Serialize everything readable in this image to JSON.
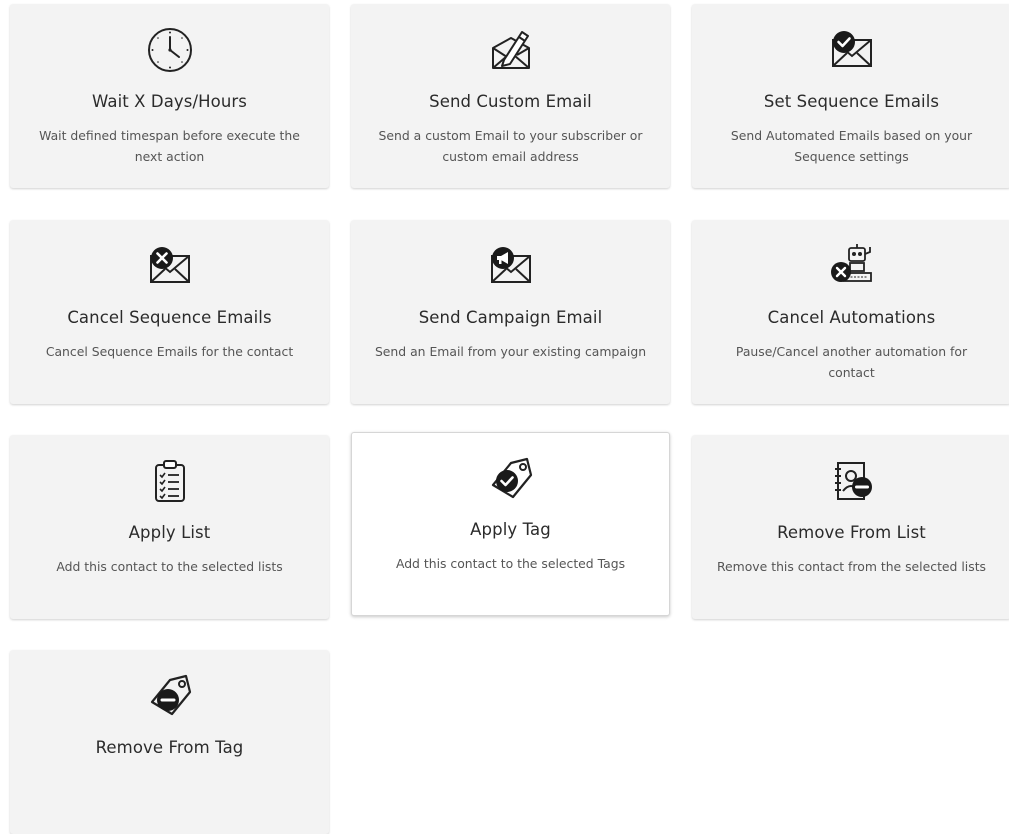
{
  "actions": [
    {
      "title": "Wait X Days/Hours",
      "description": "Wait defined timespan before execute the next action",
      "icon": "clock-icon"
    },
    {
      "title": "Send Custom Email",
      "description": "Send a custom Email to your subscriber or custom email address",
      "icon": "envelope-pen-icon"
    },
    {
      "title": "Set Sequence Emails",
      "description": "Send Automated Emails based on your Sequence settings",
      "icon": "envelope-check-icon"
    },
    {
      "title": "Cancel Sequence Emails",
      "description": "Cancel Sequence Emails for the contact",
      "icon": "envelope-cancel-icon"
    },
    {
      "title": "Send Campaign Email",
      "description": "Send an Email from your existing campaign",
      "icon": "envelope-megaphone-icon"
    },
    {
      "title": "Cancel Automations",
      "description": "Pause/Cancel another automation for contact",
      "icon": "robot-cancel-icon"
    },
    {
      "title": "Apply List",
      "description": "Add this contact to the selected lists",
      "icon": "clipboard-checklist-icon"
    },
    {
      "title": "Apply Tag",
      "description": "Add this contact to the selected Tags",
      "icon": "tag-check-icon",
      "selected": true
    },
    {
      "title": "Remove From List",
      "description": "Remove this contact from the selected lists",
      "icon": "contact-book-minus-icon"
    },
    {
      "title": "Remove From Tag",
      "description": "",
      "icon": "tag-minus-icon"
    }
  ]
}
